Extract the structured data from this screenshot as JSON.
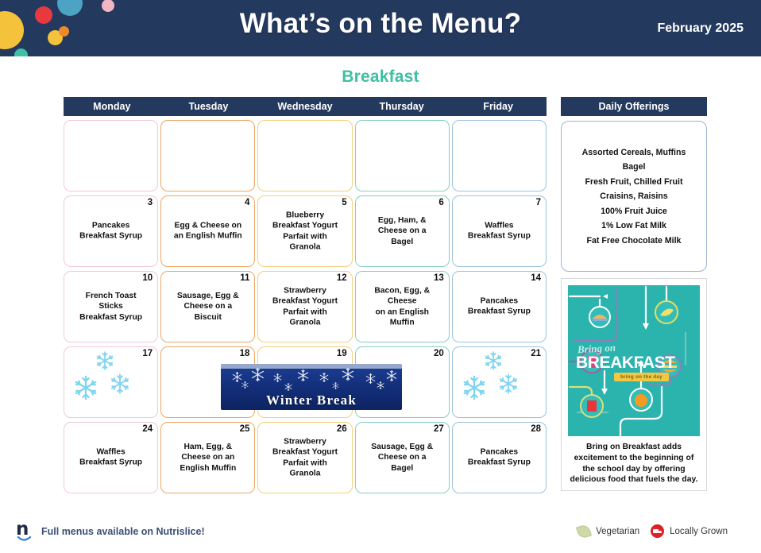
{
  "header": {
    "title": "What’s on the Menu?",
    "month": "February 2025",
    "bg_color": "#24395e"
  },
  "meal": {
    "title": "Breakfast",
    "color": "#3fbfa3"
  },
  "calendar": {
    "day_headers": [
      "Monday",
      "Tuesday",
      "Wednesday",
      "Thursday",
      "Friday"
    ],
    "column_colors": [
      "#f2c9d4",
      "#eda766",
      "#f6cf7e",
      "#86cfc0",
      "#9cc3de"
    ],
    "winter_break_label": "Winter Break",
    "weeks": [
      [
        {
          "day": "",
          "item": ""
        },
        {
          "day": "",
          "item": ""
        },
        {
          "day": "",
          "item": ""
        },
        {
          "day": "",
          "item": ""
        },
        {
          "day": "",
          "item": ""
        }
      ],
      [
        {
          "day": "3",
          "item": "Pancakes\nBreakfast Syrup"
        },
        {
          "day": "4",
          "item": "Egg & Cheese on\nan English Muffin"
        },
        {
          "day": "5",
          "item": "Blueberry\nBreakfast Yogurt\nParfait with\nGranola"
        },
        {
          "day": "6",
          "item": "Egg, Ham, &\nCheese on a\nBagel"
        },
        {
          "day": "7",
          "item": "Waffles\nBreakfast Syrup"
        }
      ],
      [
        {
          "day": "10",
          "item": "French Toast\nSticks\nBreakfast Syrup"
        },
        {
          "day": "11",
          "item": "Sausage, Egg &\nCheese on a\nBiscuit"
        },
        {
          "day": "12",
          "item": "Strawberry\nBreakfast Yogurt\nParfait with\nGranola"
        },
        {
          "day": "13",
          "item": "Bacon, Egg, &\nCheese\non an English\nMuffin"
        },
        {
          "day": "14",
          "item": "Pancakes\nBreakfast Syrup"
        }
      ],
      [
        {
          "day": "17",
          "item": "",
          "snow": true
        },
        {
          "day": "18",
          "item": ""
        },
        {
          "day": "19",
          "item": ""
        },
        {
          "day": "20",
          "item": ""
        },
        {
          "day": "21",
          "item": "",
          "snow": true
        }
      ],
      [
        {
          "day": "24",
          "item": "Waffles\nBreakfast Syrup"
        },
        {
          "day": "25",
          "item": "Ham, Egg, &\nCheese on an\nEnglish Muffin"
        },
        {
          "day": "26",
          "item": "Strawberry\nBreakfast Yogurt\nParfait with\nGranola"
        },
        {
          "day": "27",
          "item": "Sausage, Egg &\nCheese on a\nBagel"
        },
        {
          "day": "28",
          "item": "Pancakes\nBreakfast Syrup"
        }
      ]
    ]
  },
  "sidebar": {
    "title": "Daily Offerings",
    "items": [
      "Assorted Cereals, Muffins",
      "Bagel",
      "Fresh Fruit, Chilled Fruit",
      "Craisins, Raisins",
      "100% Fruit Juice",
      "1% Low Fat Milk",
      "Fat Free Chocolate Milk"
    ]
  },
  "promo": {
    "script_text": "Bring on",
    "main_text": "BREAKFAST",
    "sub_text": "bring on the day",
    "caption": "Bring on Breakfast adds excitement to the beginning of the school day by offering delicious food that fuels the day."
  },
  "footer": {
    "nutrislice_text": "Full menus available on Nutrislice!",
    "legend": [
      {
        "label": "Vegetarian",
        "icon": "leaf-icon"
      },
      {
        "label": "Locally Grown",
        "icon": "truck-icon"
      }
    ]
  }
}
